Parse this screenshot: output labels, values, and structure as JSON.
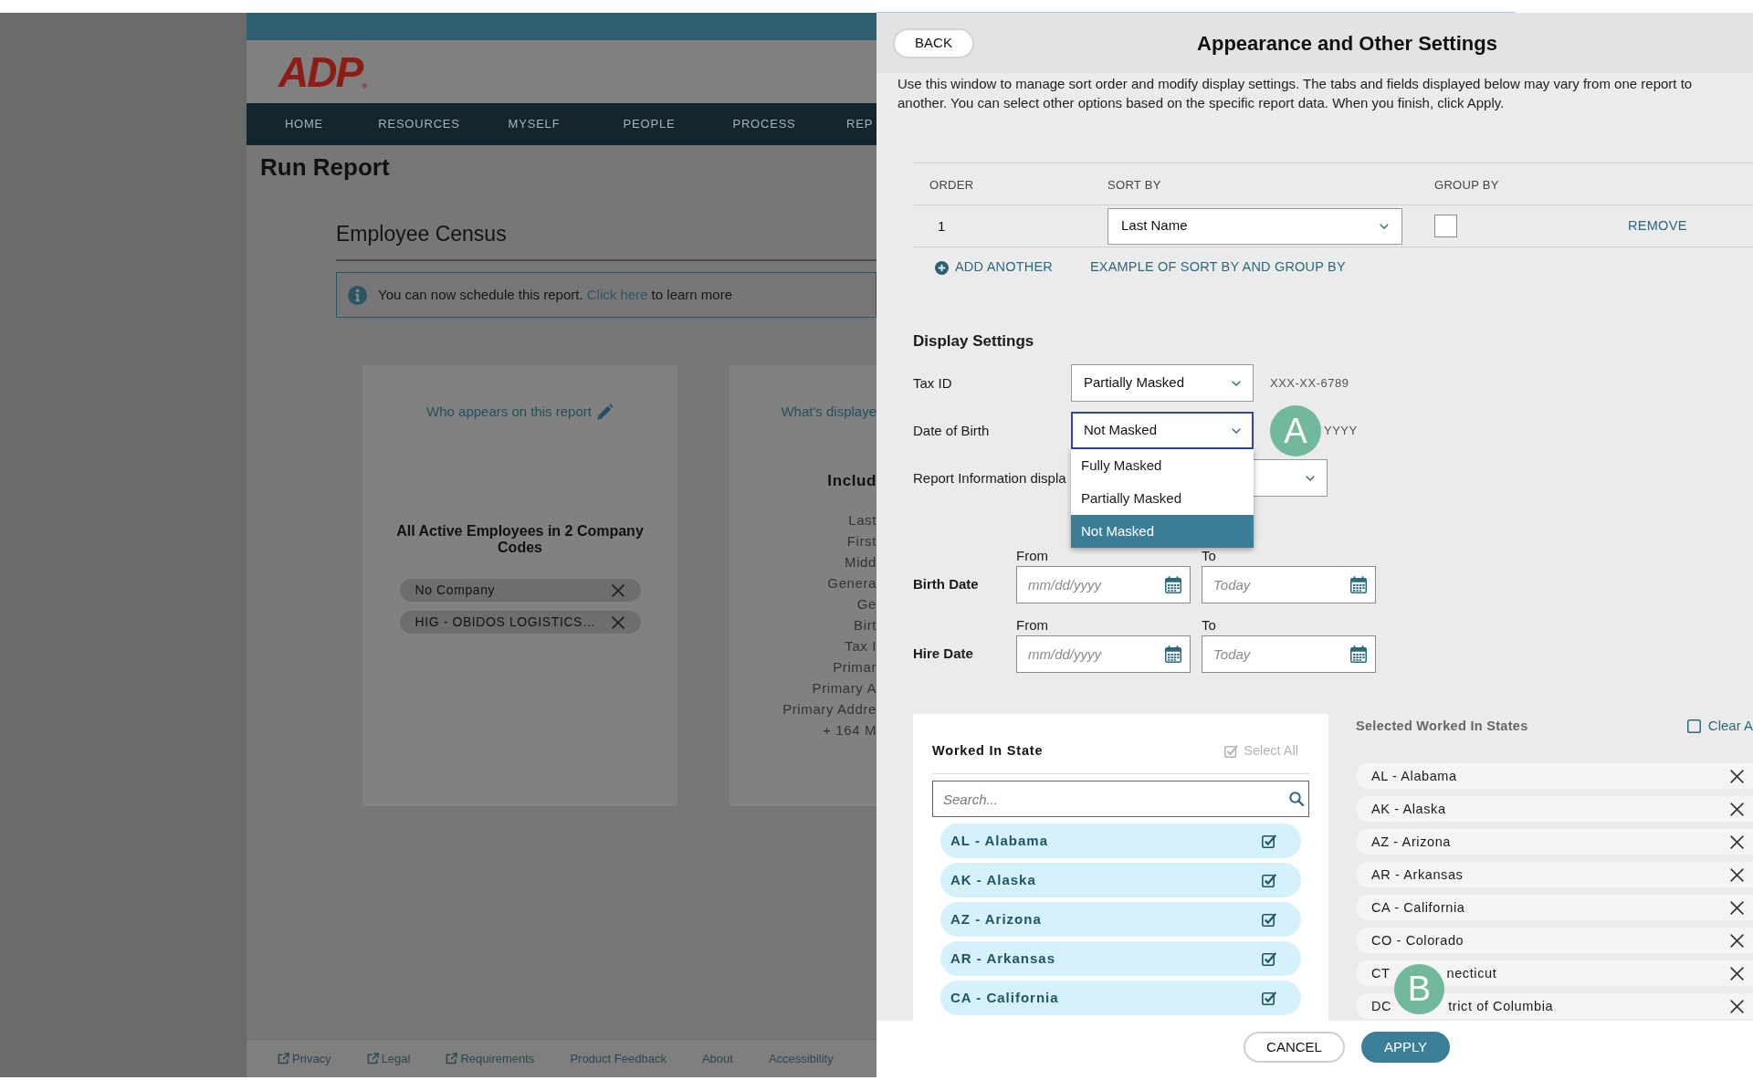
{
  "background_page": {
    "logo": "ADP$_{®}$",
    "nav_items": [
      {
        "label": "HOME"
      },
      {
        "label": "RESOURCES"
      },
      {
        "label": "MYSELF"
      },
      {
        "label": "PEOPLE"
      },
      {
        "label": "PROCESS"
      },
      {
        "label": "REP"
      }
    ],
    "page_title": "Run Report",
    "report_title": "Employee Census",
    "notice": {
      "text_before": "You can now schedule this report.",
      "link": "Click here",
      "text_after": "to learn more"
    },
    "cards": [
      {
        "kind": "filter",
        "title": "Who appears on this report",
        "heading": "All Active Employees in 2 Company Codes",
        "chips": [
          "No Company",
          "HIG - OBIDOS LOGISTICS…"
        ]
      },
      {
        "kind": "columns",
        "title": "What's displaye",
        "heading": "Includ",
        "lines": [
          "Last",
          "First",
          "Midd",
          "Genera",
          "Ge",
          "Birt",
          "Tax I",
          "Primar",
          "Primary A",
          "Primary Addre",
          "+ 164 M"
        ]
      }
    ],
    "footer_links": [
      {
        "label": "Privacy",
        "external": true
      },
      {
        "label": "Legal",
        "external": true
      },
      {
        "label": "Requirements",
        "external": true
      },
      {
        "label": "Product Feedback",
        "external": false
      },
      {
        "label": "About",
        "external": false
      },
      {
        "label": "Accessibility",
        "external": false
      }
    ]
  },
  "settings_panel": {
    "back_button": "BACK",
    "title": "Appearance and Other Settings",
    "description": "Use this window to manage sort order and modify display settings. The tabs and fields displayed below may vary from one report to another. You can select other options based on the specific report data. When you finish, click Apply.",
    "sort_table": {
      "columns": [
        "ORDER",
        "SORT BY",
        "GROUP BY"
      ],
      "rows": [
        {
          "order": "1",
          "sort_by": "Last Name",
          "group_by": false,
          "action": "REMOVE"
        }
      ]
    },
    "add_another": "ADD ANOTHER",
    "example_link": "EXAMPLE OF SORT BY AND GROUP BY",
    "display_settings": {
      "heading": "Display Settings",
      "fields": [
        {
          "kind": "masking",
          "label": "Tax ID",
          "value": "Partially Masked",
          "preview": "XXX-XX-6789",
          "expanded": false
        },
        {
          "kind": "masking",
          "label": "Date of Birth",
          "value": "Not Masked",
          "preview": "YYYY",
          "expanded": true,
          "callout": "A",
          "options": [
            {
              "label": "Fully Masked",
              "selected": false
            },
            {
              "label": "Partially Masked",
              "selected": false
            },
            {
              "label": "Not Masked",
              "selected": true
            }
          ]
        },
        {
          "kind": "display",
          "label": "Report Information displa",
          "expanded": false
        }
      ]
    },
    "date_ranges": [
      {
        "label": "Birth Date",
        "from_label": "From",
        "from_placeholder": "mm/dd/yyyy",
        "to_label": "To",
        "to_placeholder": "Today"
      },
      {
        "label": "Hire Date",
        "from_label": "From",
        "from_placeholder": "mm/dd/yyyy",
        "to_label": "To",
        "to_placeholder": "Today"
      }
    ],
    "worked_in_state": {
      "title": "Worked In State",
      "select_all": {
        "label": "Select All",
        "checked": true,
        "disabled": true
      },
      "search_placeholder": "Search...",
      "items": [
        {
          "label": "AL - Alabama",
          "checked": true
        },
        {
          "label": "AK - Alaska",
          "checked": true
        },
        {
          "label": "AZ - Arizona",
          "checked": true
        },
        {
          "label": "AR - Arkansas",
          "checked": true
        },
        {
          "label": "CA - California",
          "checked": true
        }
      ]
    },
    "selected_states": {
      "title": "Selected Worked In States",
      "clear_all": {
        "label": "Clear A",
        "checked": false
      },
      "callout": "B",
      "items": [
        {
          "parts": [
            "AL - Alabama"
          ]
        },
        {
          "parts": [
            "AK - Alaska"
          ]
        },
        {
          "parts": [
            "AZ - Arizona"
          ]
        },
        {
          "parts": [
            "AR - Arkansas"
          ]
        },
        {
          "parts": [
            "CA - California"
          ]
        },
        {
          "parts": [
            "CO - Colorado"
          ]
        },
        {
          "parts": [
            "CT",
            "necticut"
          ]
        },
        {
          "parts": [
            "DC",
            "trict of Columbia"
          ]
        }
      ]
    },
    "buttons": [
      {
        "label": "CANCEL",
        "kind": "secondary"
      },
      {
        "label": "APPLY",
        "kind": "primary"
      }
    ]
  }
}
